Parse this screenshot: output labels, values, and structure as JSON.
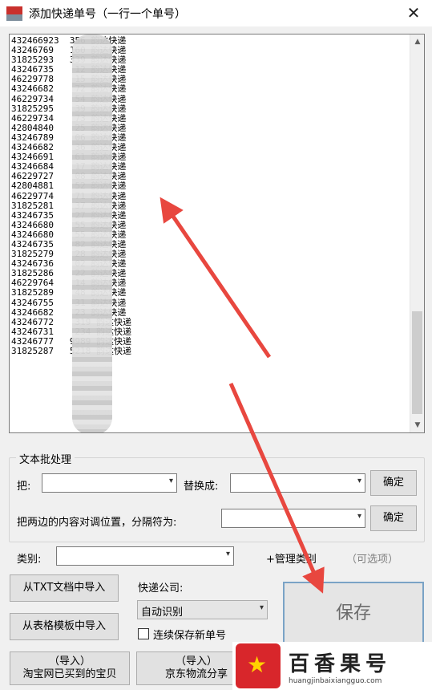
{
  "window": {
    "title": "添加快递单号（一行一个单号）",
    "close_symbol": "✕"
  },
  "tracking_list": {
    "lines": [
      "432466923  356 韵达快递",
      "43246769   160 韵达快递",
      "31825293   339 韵达快递",
      "43246735    12 韵达快递",
      "46229778    15 韵达快递",
      "43246682    72 韵达快递",
      "46229734    54 韵达快递",
      "31825295    39 韵达快递",
      "46229734    73 韵达快递",
      "42804840    25 韵达快递",
      "43246789    06 韵达快递",
      "43246682    36 韵达快递",
      "43246691    61 韵达快递",
      "43246684    17 韵达快递",
      "46229727    08 韵达快递",
      "42804881    52 韵达快递",
      "46229774    71 韵达快递",
      "31825281    37 韵达快递",
      "43246735    27 韵达快递",
      "43246680    55 韵达快递",
      "43246680    55 韵达快递",
      "43246735    82 韵达快递",
      "31825279    28 韵达快递",
      "43246736    02 韵达快递",
      "31825286    22 韵达快递",
      "46229764    14 韵达快递",
      "31825289    48 韵达快递",
      "43246755    31 韵达快递",
      "43246682    23 韵达快递",
      "43246772    319 韵达快递",
      "43246731    234 韵达快递",
      "43246777   9989 韵达快递",
      "31825287   5218 韵达快递"
    ]
  },
  "text_processing": {
    "group_title": "文本批处理",
    "replace_label": "把:",
    "replace_with_label": "替换成:",
    "confirm_1": "确定",
    "swap_label": "把两边的内容对调位置，分隔符为:",
    "confirm_2": "确定"
  },
  "category": {
    "label": "类别:",
    "manage": "+管理类别",
    "optional": "（可选项）"
  },
  "import": {
    "txt": "从TXT文档中导入",
    "table": "从表格模板中导入",
    "taobao_line1": "（导入）",
    "taobao_line2": "淘宝网已买到的宝贝",
    "jd_line1": "（导入）",
    "jd_line2": "京东物流分享"
  },
  "courier": {
    "label": "快递公司:",
    "selected": "自动识别",
    "continuous_save": "连续保存新单号"
  },
  "save_label": "保存",
  "watermark": {
    "cn": "百香果号",
    "en": "huangjinbaixiangguo.com"
  },
  "icons": {
    "dropdown": "▾",
    "scroll_up": "▲",
    "scroll_down": "▼",
    "star": "★"
  }
}
